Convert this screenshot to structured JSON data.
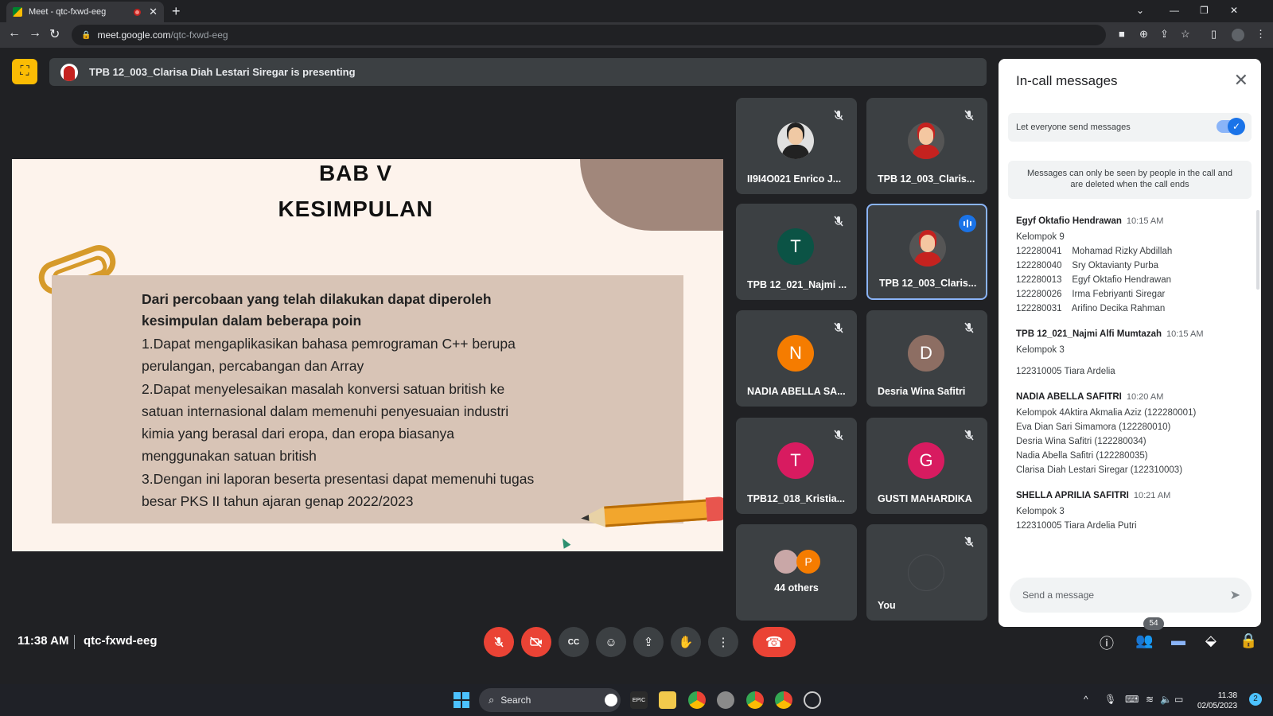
{
  "browser": {
    "tab_title": "Meet - qtc-fxwd-eeg",
    "url_domain": "meet.google.com",
    "url_path": "/qtc-fxwd-eeg"
  },
  "banner": {
    "text": "TPB 12_003_Clarisa Diah Lestari Siregar is presenting"
  },
  "slide": {
    "title_line1": "BAB V",
    "title_line2": "KESIMPULAN",
    "lead_line1": "Dari percobaan yang telah dilakukan dapat diperoleh",
    "lead_line2": "kesimpulan dalam beberapa poin",
    "points": [
      "1.Dapat mengaplikasikan bahasa pemrograman C++ berupa",
      "perulangan, percabangan dan Array",
      "2.Dapat menyelesaikan masalah konversi satuan british ke",
      "satuan internasional dalam memenuhi penyesuaian industri",
      "kimia yang berasal dari eropa, dan eropa biasanya",
      "menggunakan satuan british",
      "3.Dengan ini laporan beserta presentasi dapat memenuhi tugas",
      "besar PKS II tahun ajaran genap 2022/2023"
    ]
  },
  "tiles": [
    {
      "name": "II9I4O021 Enrico J...",
      "type": "photo",
      "muted": true
    },
    {
      "name": "TPB 12_003_Claris...",
      "type": "photo",
      "muted": true
    },
    {
      "name": "TPB 12_021_Najmi ...",
      "letter": "T",
      "color": "#0b5345",
      "muted": true
    },
    {
      "name": "TPB 12_003_Claris...",
      "type": "photo",
      "speaking": true
    },
    {
      "name": "NADIA ABELLA SA...",
      "letter": "N",
      "color": "#f57c00",
      "muted": true
    },
    {
      "name": "Desria Wina Safitri",
      "letter": "D",
      "color": "#8d6e63",
      "muted": true
    },
    {
      "name": "TPB12_018_Kristia...",
      "letter": "T",
      "color": "#d81b60",
      "muted": true
    },
    {
      "name": "GUSTI MAHARDIKA",
      "letter": "G",
      "color": "#d81b60",
      "muted": true
    },
    {
      "name": "44 others",
      "letter": "P",
      "color": "#f57c00"
    },
    {
      "name": "You",
      "muted": true
    }
  ],
  "chat": {
    "title": "In-call messages",
    "toggle_label": "Let everyone send messages",
    "toggle_on": true,
    "notice": "Messages can only be seen by people in the call and are deleted when the call ends",
    "input_placeholder": "Send a message",
    "messages": [
      {
        "sender": "Egyf Oktafio Hendrawan",
        "time": "10:15 AM",
        "lines": [
          "Kelompok 9",
          "122280041    Mohamad Rizky Abdillah",
          "122280040    Sry Oktavianty Purba",
          "122280013    Egyf Oktafio Hendrawan",
          "122280026    Irma Febriyanti Siregar",
          "122280031    Arifino Decika Rahman"
        ]
      },
      {
        "sender": "TPB 12_021_Najmi Alfi Mumtazah",
        "time": "10:15 AM",
        "lines": [
          "Kelompok 3",
          "",
          "122310005 Tiara Ardelia"
        ]
      },
      {
        "sender": "NADIA ABELLA SAFITRI",
        "time": "10:20 AM",
        "lines": [
          "Kelompok 4Aktira Akmalia Aziz (122280001)",
          "Eva Dian Sari Simamora (122280010)",
          "Desria Wina Safitri (122280034)",
          "Nadia Abella Safitri (122280035)",
          "Clarisa Diah Lestari Siregar (122310003)"
        ]
      },
      {
        "sender": "SHELLA APRILIA SAFITRI",
        "time": "10:21 AM",
        "lines": [
          "Kelompok 3",
          "122310005 Tiara Ardelia Putri"
        ]
      }
    ]
  },
  "bottom": {
    "time": "11:38 AM",
    "meeting_code": "qtc-fxwd-eeg",
    "participants_count": "54"
  },
  "taskbar": {
    "search_label": "Search",
    "clock_time": "11.38",
    "clock_date": "02/05/2023",
    "notifications": "2"
  },
  "colors": {
    "meet_bg": "#202124",
    "tile_bg": "#3c4043",
    "accent_blue": "#1a73e8",
    "danger_red": "#ea4335",
    "present_yellow": "#fbbc04"
  }
}
